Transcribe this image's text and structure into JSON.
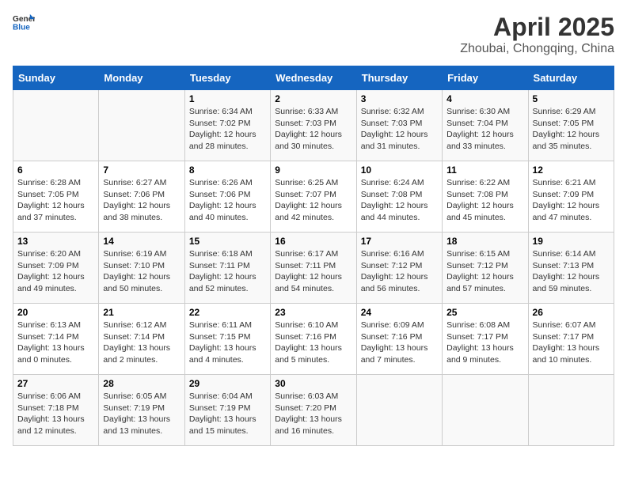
{
  "header": {
    "logo_general": "General",
    "logo_blue": "Blue",
    "title": "April 2025",
    "subtitle": "Zhoubai, Chongqing, China"
  },
  "days_of_week": [
    "Sunday",
    "Monday",
    "Tuesday",
    "Wednesday",
    "Thursday",
    "Friday",
    "Saturday"
  ],
  "weeks": [
    [
      {
        "day": "",
        "sunrise": "",
        "sunset": "",
        "daylight": ""
      },
      {
        "day": "",
        "sunrise": "",
        "sunset": "",
        "daylight": ""
      },
      {
        "day": "1",
        "sunrise": "Sunrise: 6:34 AM",
        "sunset": "Sunset: 7:02 PM",
        "daylight": "Daylight: 12 hours and 28 minutes."
      },
      {
        "day": "2",
        "sunrise": "Sunrise: 6:33 AM",
        "sunset": "Sunset: 7:03 PM",
        "daylight": "Daylight: 12 hours and 30 minutes."
      },
      {
        "day": "3",
        "sunrise": "Sunrise: 6:32 AM",
        "sunset": "Sunset: 7:03 PM",
        "daylight": "Daylight: 12 hours and 31 minutes."
      },
      {
        "day": "4",
        "sunrise": "Sunrise: 6:30 AM",
        "sunset": "Sunset: 7:04 PM",
        "daylight": "Daylight: 12 hours and 33 minutes."
      },
      {
        "day": "5",
        "sunrise": "Sunrise: 6:29 AM",
        "sunset": "Sunset: 7:05 PM",
        "daylight": "Daylight: 12 hours and 35 minutes."
      }
    ],
    [
      {
        "day": "6",
        "sunrise": "Sunrise: 6:28 AM",
        "sunset": "Sunset: 7:05 PM",
        "daylight": "Daylight: 12 hours and 37 minutes."
      },
      {
        "day": "7",
        "sunrise": "Sunrise: 6:27 AM",
        "sunset": "Sunset: 7:06 PM",
        "daylight": "Daylight: 12 hours and 38 minutes."
      },
      {
        "day": "8",
        "sunrise": "Sunrise: 6:26 AM",
        "sunset": "Sunset: 7:06 PM",
        "daylight": "Daylight: 12 hours and 40 minutes."
      },
      {
        "day": "9",
        "sunrise": "Sunrise: 6:25 AM",
        "sunset": "Sunset: 7:07 PM",
        "daylight": "Daylight: 12 hours and 42 minutes."
      },
      {
        "day": "10",
        "sunrise": "Sunrise: 6:24 AM",
        "sunset": "Sunset: 7:08 PM",
        "daylight": "Daylight: 12 hours and 44 minutes."
      },
      {
        "day": "11",
        "sunrise": "Sunrise: 6:22 AM",
        "sunset": "Sunset: 7:08 PM",
        "daylight": "Daylight: 12 hours and 45 minutes."
      },
      {
        "day": "12",
        "sunrise": "Sunrise: 6:21 AM",
        "sunset": "Sunset: 7:09 PM",
        "daylight": "Daylight: 12 hours and 47 minutes."
      }
    ],
    [
      {
        "day": "13",
        "sunrise": "Sunrise: 6:20 AM",
        "sunset": "Sunset: 7:09 PM",
        "daylight": "Daylight: 12 hours and 49 minutes."
      },
      {
        "day": "14",
        "sunrise": "Sunrise: 6:19 AM",
        "sunset": "Sunset: 7:10 PM",
        "daylight": "Daylight: 12 hours and 50 minutes."
      },
      {
        "day": "15",
        "sunrise": "Sunrise: 6:18 AM",
        "sunset": "Sunset: 7:11 PM",
        "daylight": "Daylight: 12 hours and 52 minutes."
      },
      {
        "day": "16",
        "sunrise": "Sunrise: 6:17 AM",
        "sunset": "Sunset: 7:11 PM",
        "daylight": "Daylight: 12 hours and 54 minutes."
      },
      {
        "day": "17",
        "sunrise": "Sunrise: 6:16 AM",
        "sunset": "Sunset: 7:12 PM",
        "daylight": "Daylight: 12 hours and 56 minutes."
      },
      {
        "day": "18",
        "sunrise": "Sunrise: 6:15 AM",
        "sunset": "Sunset: 7:12 PM",
        "daylight": "Daylight: 12 hours and 57 minutes."
      },
      {
        "day": "19",
        "sunrise": "Sunrise: 6:14 AM",
        "sunset": "Sunset: 7:13 PM",
        "daylight": "Daylight: 12 hours and 59 minutes."
      }
    ],
    [
      {
        "day": "20",
        "sunrise": "Sunrise: 6:13 AM",
        "sunset": "Sunset: 7:14 PM",
        "daylight": "Daylight: 13 hours and 0 minutes."
      },
      {
        "day": "21",
        "sunrise": "Sunrise: 6:12 AM",
        "sunset": "Sunset: 7:14 PM",
        "daylight": "Daylight: 13 hours and 2 minutes."
      },
      {
        "day": "22",
        "sunrise": "Sunrise: 6:11 AM",
        "sunset": "Sunset: 7:15 PM",
        "daylight": "Daylight: 13 hours and 4 minutes."
      },
      {
        "day": "23",
        "sunrise": "Sunrise: 6:10 AM",
        "sunset": "Sunset: 7:16 PM",
        "daylight": "Daylight: 13 hours and 5 minutes."
      },
      {
        "day": "24",
        "sunrise": "Sunrise: 6:09 AM",
        "sunset": "Sunset: 7:16 PM",
        "daylight": "Daylight: 13 hours and 7 minutes."
      },
      {
        "day": "25",
        "sunrise": "Sunrise: 6:08 AM",
        "sunset": "Sunset: 7:17 PM",
        "daylight": "Daylight: 13 hours and 9 minutes."
      },
      {
        "day": "26",
        "sunrise": "Sunrise: 6:07 AM",
        "sunset": "Sunset: 7:17 PM",
        "daylight": "Daylight: 13 hours and 10 minutes."
      }
    ],
    [
      {
        "day": "27",
        "sunrise": "Sunrise: 6:06 AM",
        "sunset": "Sunset: 7:18 PM",
        "daylight": "Daylight: 13 hours and 12 minutes."
      },
      {
        "day": "28",
        "sunrise": "Sunrise: 6:05 AM",
        "sunset": "Sunset: 7:19 PM",
        "daylight": "Daylight: 13 hours and 13 minutes."
      },
      {
        "day": "29",
        "sunrise": "Sunrise: 6:04 AM",
        "sunset": "Sunset: 7:19 PM",
        "daylight": "Daylight: 13 hours and 15 minutes."
      },
      {
        "day": "30",
        "sunrise": "Sunrise: 6:03 AM",
        "sunset": "Sunset: 7:20 PM",
        "daylight": "Daylight: 13 hours and 16 minutes."
      },
      {
        "day": "",
        "sunrise": "",
        "sunset": "",
        "daylight": ""
      },
      {
        "day": "",
        "sunrise": "",
        "sunset": "",
        "daylight": ""
      },
      {
        "day": "",
        "sunrise": "",
        "sunset": "",
        "daylight": ""
      }
    ]
  ]
}
